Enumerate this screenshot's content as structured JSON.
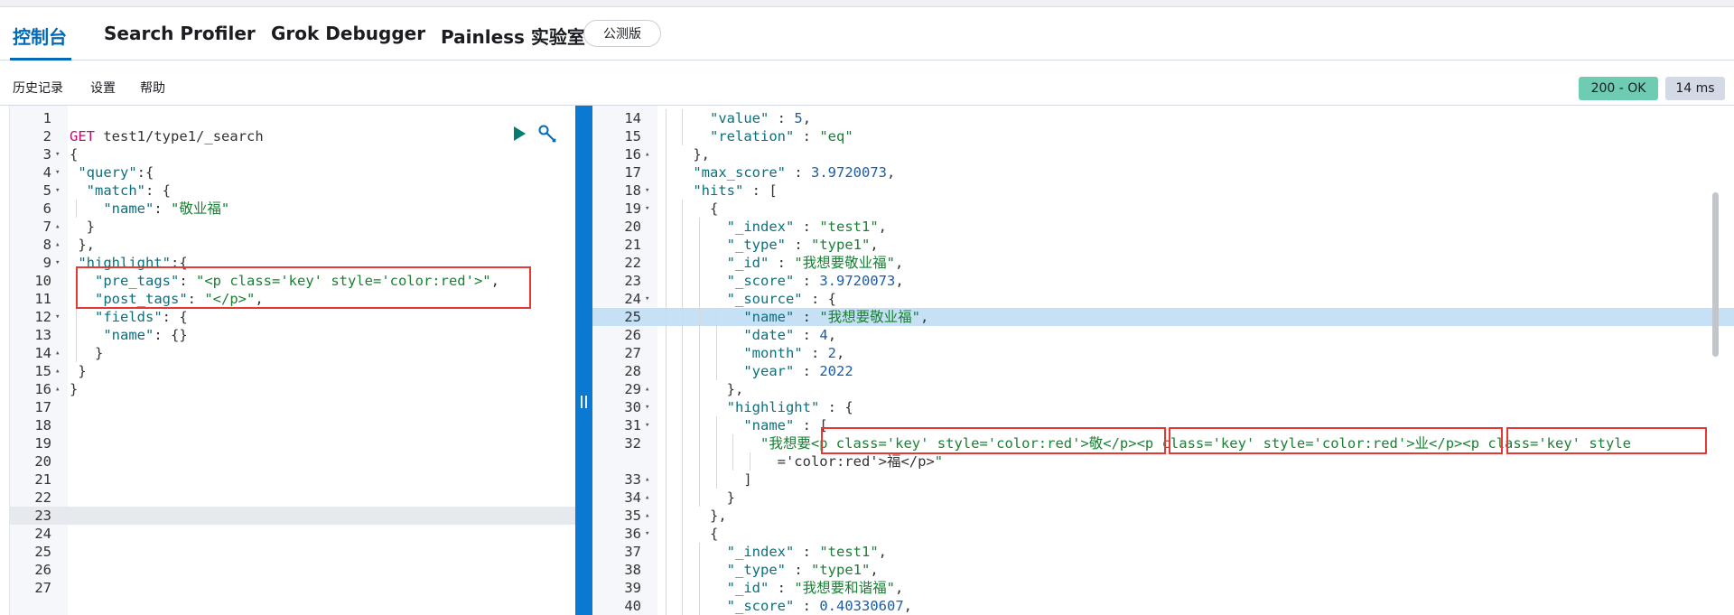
{
  "tabs": [
    {
      "label": "控制台",
      "active": true
    },
    {
      "label": "Search Profiler"
    },
    {
      "label": "Grok Debugger"
    },
    {
      "label": "Painless 实验室"
    }
  ],
  "beta_badge": "公测版",
  "subnav": {
    "history": "历史记录",
    "settings": "设置",
    "help": "帮助"
  },
  "response_status": {
    "code": "200 - OK",
    "time": "14 ms"
  },
  "icons": {
    "run": "play-icon",
    "settings": "wrench-icon",
    "splitter": "drag-handle-icon"
  },
  "colors": {
    "accent": "#006bb8",
    "status_ok": "#6dccb1",
    "highlight_box": "#e53935"
  },
  "editor": {
    "lines": [
      {
        "n": "1",
        "text": ""
      },
      {
        "n": "2",
        "text": "GET test1/type1/_search"
      },
      {
        "n": "3",
        "fold": "▾",
        "text": "{"
      },
      {
        "n": "4",
        "fold": "▾",
        "text": " \"query\":{"
      },
      {
        "n": "5",
        "fold": "▾",
        "text": "  \"match\": {"
      },
      {
        "n": "6",
        "text": "    \"name\": \"敬业福\""
      },
      {
        "n": "7",
        "fold": "▴",
        "text": "  }"
      },
      {
        "n": "8",
        "fold": "▴",
        "text": " },"
      },
      {
        "n": "9",
        "fold": "▾",
        "text": " \"highlight\":{"
      },
      {
        "n": "10",
        "text": "   \"pre_tags\": \"<p class='key' style='color:red'>\","
      },
      {
        "n": "11",
        "text": "   \"post_tags\": \"</p>\","
      },
      {
        "n": "12",
        "fold": "▾",
        "text": "   \"fields\": {"
      },
      {
        "n": "13",
        "text": "    \"name\": {}"
      },
      {
        "n": "14",
        "fold": "▴",
        "text": "   }"
      },
      {
        "n": "15",
        "fold": "▴",
        "text": " }"
      },
      {
        "n": "16",
        "fold": "▴",
        "text": "}"
      },
      {
        "n": "17",
        "text": ""
      },
      {
        "n": "18",
        "text": ""
      },
      {
        "n": "19",
        "text": ""
      },
      {
        "n": "20",
        "text": ""
      },
      {
        "n": "21",
        "text": ""
      },
      {
        "n": "22",
        "text": ""
      },
      {
        "n": "23",
        "text": "",
        "active": true
      },
      {
        "n": "24",
        "text": ""
      },
      {
        "n": "25",
        "text": ""
      },
      {
        "n": "26",
        "text": ""
      },
      {
        "n": "27",
        "text": ""
      }
    ]
  },
  "response": {
    "lines": [
      {
        "n": "14",
        "text": "      \"value\" : 5,"
      },
      {
        "n": "15",
        "text": "      \"relation\" : \"eq\""
      },
      {
        "n": "16",
        "fold": "▴",
        "text": "    },"
      },
      {
        "n": "17",
        "text": "    \"max_score\" : 3.9720073,"
      },
      {
        "n": "18",
        "fold": "▾",
        "text": "    \"hits\" : ["
      },
      {
        "n": "19",
        "fold": "▾",
        "text": "      {"
      },
      {
        "n": "20",
        "text": "        \"_index\" : \"test1\","
      },
      {
        "n": "21",
        "text": "        \"_type\" : \"type1\","
      },
      {
        "n": "22",
        "text": "        \"_id\" : \"我想要敬业福\","
      },
      {
        "n": "23",
        "text": "        \"_score\" : 3.9720073,"
      },
      {
        "n": "24",
        "fold": "▾",
        "text": "        \"_source\" : {"
      },
      {
        "n": "25",
        "text": "          \"name\" : \"我想要敬业福\",",
        "active": true
      },
      {
        "n": "26",
        "text": "          \"date\" : 4,"
      },
      {
        "n": "27",
        "text": "          \"month\" : 2,"
      },
      {
        "n": "28",
        "text": "          \"year\" : 2022"
      },
      {
        "n": "29",
        "fold": "▴",
        "text": "        },"
      },
      {
        "n": "30",
        "fold": "▾",
        "text": "        \"highlight\" : {"
      },
      {
        "n": "31",
        "fold": "▾",
        "text": "          \"name\" : ["
      },
      {
        "n": "32",
        "text": "            \"我想要<p class='key' style='color:red'>敬</p><p class='key' style='color:red'>业</p><p class='key' style"
      },
      {
        "n": "",
        "text": "              ='color:red'>福</p>\""
      },
      {
        "n": "33",
        "fold": "▴",
        "text": "          ]"
      },
      {
        "n": "34",
        "fold": "▴",
        "text": "        }"
      },
      {
        "n": "35",
        "fold": "▴",
        "text": "      },"
      },
      {
        "n": "36",
        "fold": "▾",
        "text": "      {"
      },
      {
        "n": "37",
        "text": "        \"_index\" : \"test1\","
      },
      {
        "n": "38",
        "text": "        \"_type\" : \"type1\","
      },
      {
        "n": "39",
        "text": "        \"_id\" : \"我想要和谐福\","
      },
      {
        "n": "40",
        "text": "        \"_score\" : 0.40330607,"
      }
    ]
  }
}
